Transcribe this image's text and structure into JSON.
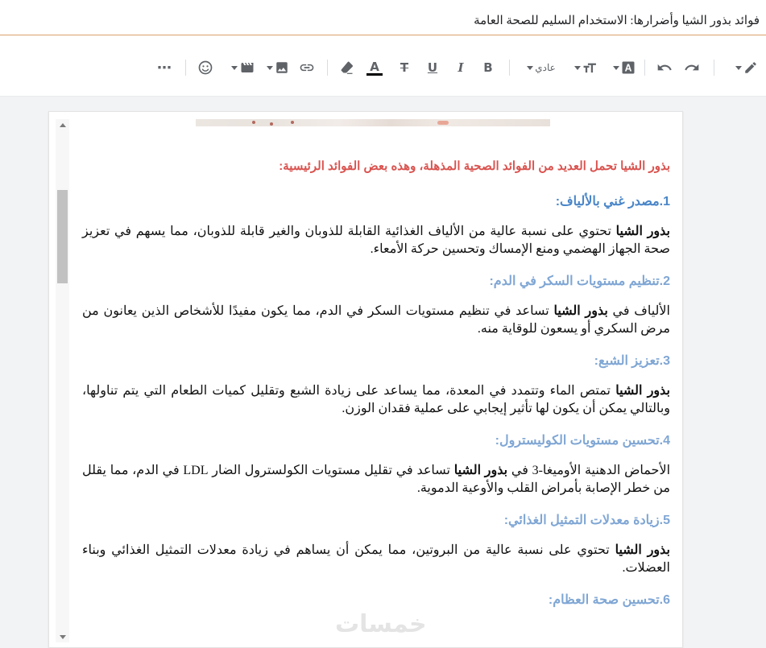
{
  "post_title": "فوائد بذور الشيا وأضرارها: الاستخدام السليم للصحة العامة",
  "toolbar": {
    "font_size_value": "عادي",
    "icons": [
      "pencil-icon",
      "redo-icon",
      "undo-icon",
      "text-background-icon",
      "text-size-icon",
      "bold-icon",
      "italic-icon",
      "underline-icon",
      "strikethrough-icon",
      "text-color-icon",
      "clear-formatting-icon",
      "link-icon",
      "image-icon",
      "video-icon",
      "emoji-icon",
      "more-icon"
    ],
    "bold_glyph": "B",
    "italic_glyph": "I",
    "underline_glyph": "U",
    "strike_glyph": "T",
    "text_color_glyph": "A",
    "more_glyph": "⋯"
  },
  "content": {
    "intro": "بذور الشيا تحمل العديد من الفوائد الصحية المذهلة، وهذه بعض الفوائد الرئيسية:",
    "sections": [
      {
        "heading": "1.مصدر غني بالألياف:",
        "bold_lead": "بذور الشيا",
        "text_before": "",
        "text_after": " تحتوي على نسبة عالية من الألياف الغذائية القابلة للذوبان والغير قابلة للذوبان، مما يسهم في تعزيز صحة الجهاز الهضمي ومنع الإمساك وتحسين حركة الأمعاء."
      },
      {
        "heading": "2.تنظيم مستويات السكر في الدم:",
        "bold_lead": "بذور الشيا",
        "text_before": "الألياف في ",
        "text_after": " تساعد في تنظيم مستويات السكر في الدم، مما يكون مفيدًا للأشخاص الذين يعانون من مرض السكري أو يسعون للوقاية منه."
      },
      {
        "heading": "3.تعزيز الشبع:",
        "bold_lead": "بذور الشيا",
        "text_before": "",
        "text_after": " تمتص الماء وتتمدد في المعدة، مما يساعد على زيادة الشبع وتقليل كميات الطعام التي يتم تناولها، وبالتالي يمكن أن يكون لها تأثير إيجابي على عملية فقدان الوزن."
      },
      {
        "heading": "4.تحسين مستويات الكوليسترول:",
        "bold_lead": "بذور الشيا",
        "text_before": "الأحماض الدهنية الأوميغا-3 في ",
        "text_after": " تساعد في تقليل مستويات الكولسترول الضار LDL في الدم، مما يقلل من خطر الإصابة بأمراض القلب والأوعية الدموية."
      },
      {
        "heading": "5.زيادة معدلات التمثيل الغذائي:",
        "bold_lead": "بذور الشيا",
        "text_before": "",
        "text_after": " تحتوي على نسبة عالية من البروتين، مما يمكن أن يساهم في زيادة معدلات التمثيل الغذائي وبناء العضلات."
      },
      {
        "heading": "6.تحسين صحة العظام:"
      }
    ]
  },
  "watermark": "خمسات",
  "colors": {
    "intro": "#d9534f",
    "heading": "#4a86c8",
    "title_underline": "#d7a16b"
  }
}
